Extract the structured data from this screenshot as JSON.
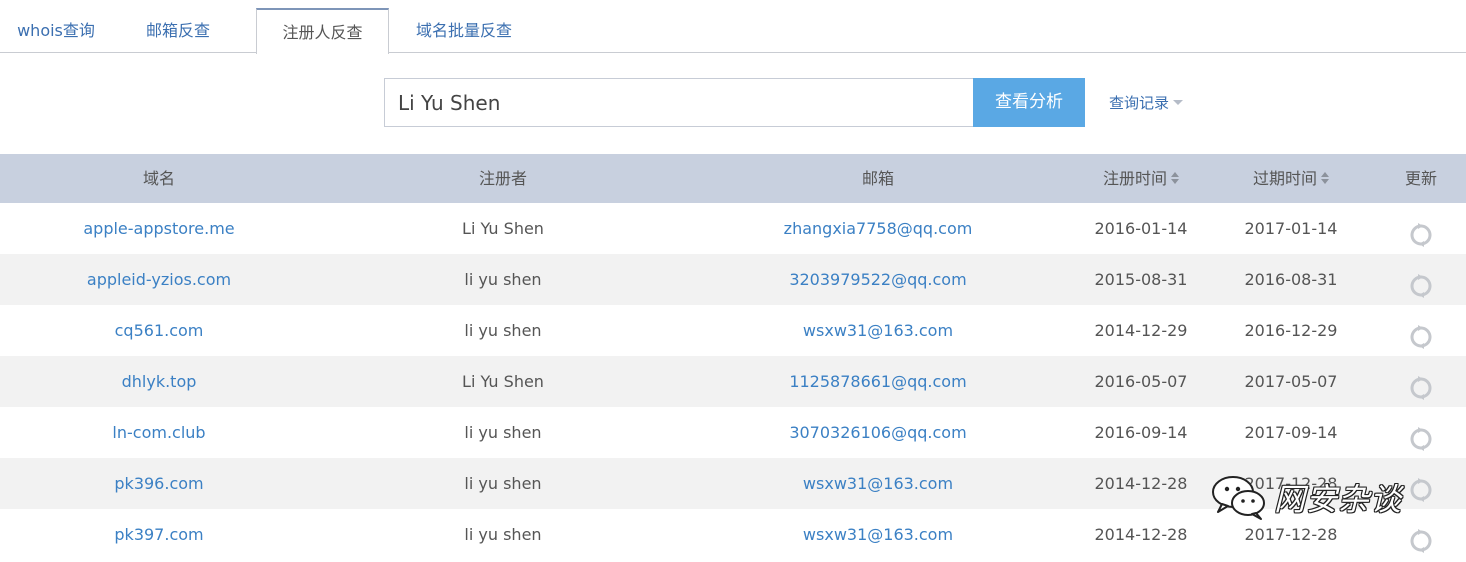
{
  "tabs": [
    {
      "label": "whois查询"
    },
    {
      "label": "邮箱反查"
    },
    {
      "label": "注册人反查"
    },
    {
      "label": "域名批量反查"
    }
  ],
  "search": {
    "value": "Li Yu Shen",
    "button_label": "查看分析",
    "history_label": "查询记录"
  },
  "table": {
    "headers": {
      "domain": "域名",
      "registrant": "注册者",
      "email": "邮箱",
      "reg_date": "注册时间",
      "exp_date": "过期时间",
      "refresh": "更新"
    },
    "rows": [
      {
        "domain": "apple-appstore.me",
        "registrant": "Li Yu Shen",
        "email": "zhangxia7758@qq.com",
        "reg_date": "2016-01-14",
        "exp_date": "2017-01-14"
      },
      {
        "domain": "appleid-yzios.com",
        "registrant": "li yu shen",
        "email": "3203979522@qq.com",
        "reg_date": "2015-08-31",
        "exp_date": "2016-08-31"
      },
      {
        "domain": "cq561.com",
        "registrant": "li yu shen",
        "email": "wsxw31@163.com",
        "reg_date": "2014-12-29",
        "exp_date": "2016-12-29"
      },
      {
        "domain": "dhlyk.top",
        "registrant": "Li Yu Shen",
        "email": "1125878661@qq.com",
        "reg_date": "2016-05-07",
        "exp_date": "2017-05-07"
      },
      {
        "domain": "ln-com.club",
        "registrant": "li yu shen",
        "email": "3070326106@qq.com",
        "reg_date": "2016-09-14",
        "exp_date": "2017-09-14"
      },
      {
        "domain": "pk396.com",
        "registrant": "li yu shen",
        "email": "wsxw31@163.com",
        "reg_date": "2014-12-28",
        "exp_date": "2017-12-28"
      },
      {
        "domain": "pk397.com",
        "registrant": "li yu shen",
        "email": "wsxw31@163.com",
        "reg_date": "2014-12-28",
        "exp_date": "2017-12-28"
      }
    ]
  },
  "watermark": {
    "text": "网安杂谈"
  },
  "colors": {
    "accent": "#5aa8e4",
    "link": "#3b80c4",
    "header_bg": "#c8d0df",
    "alt_row": "#f2f2f2"
  },
  "icons": {
    "refresh": "refresh-icon",
    "sort": "sort-icon",
    "caret": "caret-down-icon",
    "wechat": "wechat-icon"
  }
}
